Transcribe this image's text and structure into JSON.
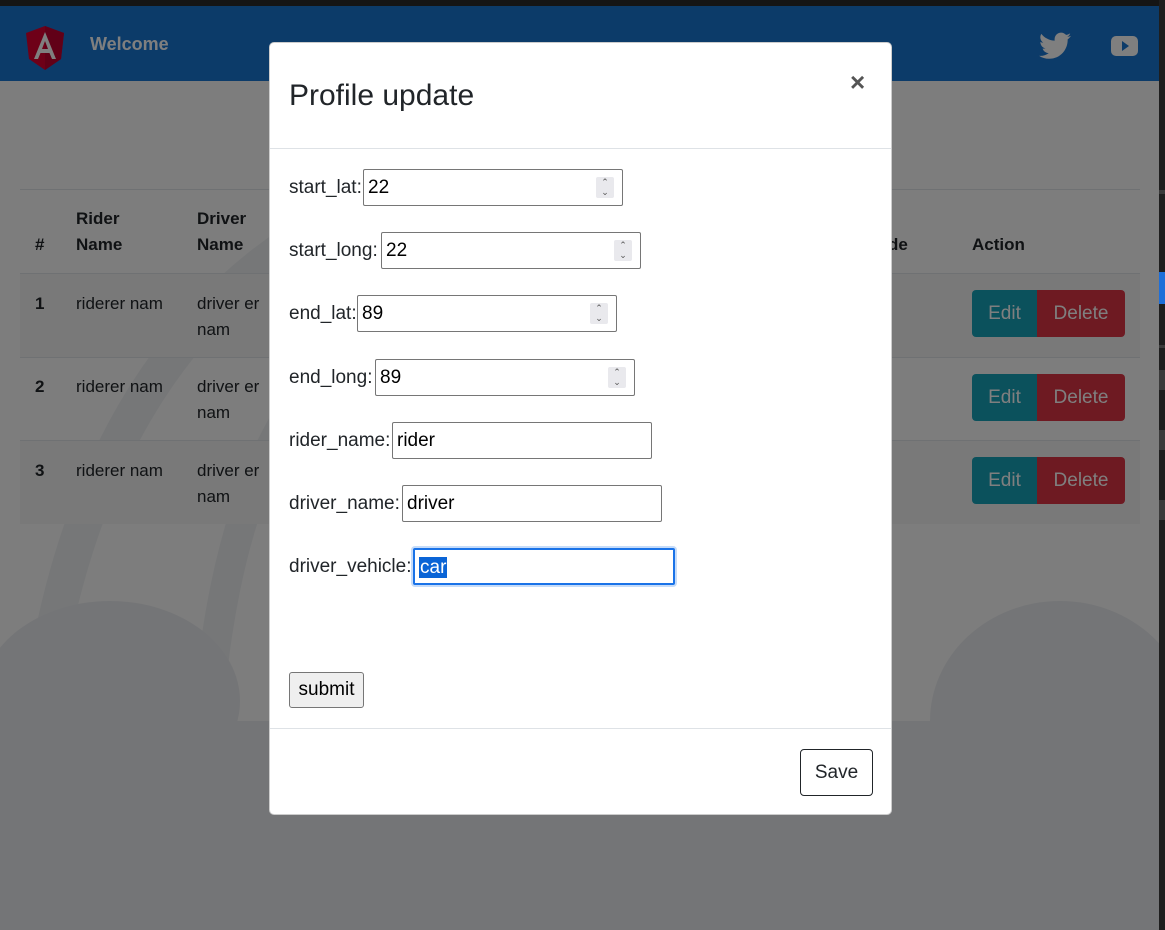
{
  "app": {
    "welcome": "Welcome"
  },
  "table": {
    "headers": {
      "index": "#",
      "rider_name": "Rider Name",
      "driver_name": "Driver Name",
      "partial": "de",
      "action": "Action"
    },
    "rows": [
      {
        "index": "1",
        "rider": "riderer nam",
        "driver": "driver er nam",
        "edit": "Edit",
        "delete": "Delete"
      },
      {
        "index": "2",
        "rider": "riderer nam",
        "driver": "driver er nam",
        "edit": "Edit",
        "delete": "Delete"
      },
      {
        "index": "3",
        "rider": "riderer nam",
        "driver": "driver er nam",
        "edit": "Edit",
        "delete": "Delete"
      }
    ]
  },
  "modal": {
    "title": "Profile update",
    "close": "×",
    "fields": [
      {
        "label": "start_lat:",
        "value": "22"
      },
      {
        "label": "start_long:",
        "value": "22"
      },
      {
        "label": "end_lat:",
        "value": "89"
      },
      {
        "label": "end_long:",
        "value": "89"
      },
      {
        "label": "rider_name:",
        "value": "rider"
      },
      {
        "label": "driver_name:",
        "value": "driver"
      },
      {
        "label": "driver_vehicle:",
        "value": "car"
      }
    ],
    "submit": "submit",
    "save": "Save"
  },
  "icons": {
    "logo": "angular-logo-icon",
    "twitter": "twitter-icon",
    "youtube": "youtube-icon"
  },
  "colors": {
    "header": "#1976d2",
    "edit": "#17a2b8",
    "delete": "#dc3545",
    "focus": "#1a73e8"
  }
}
